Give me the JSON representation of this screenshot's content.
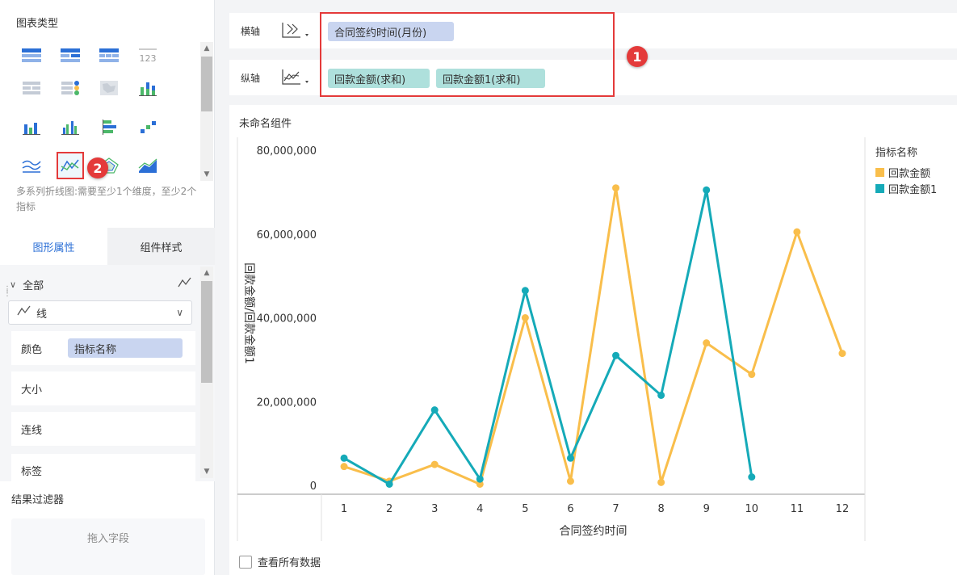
{
  "left_panel": {
    "chart_type_title": "图表类型",
    "icon_123_label": "123",
    "hint": "多系列折线图:需要至少1个维度，至少2个指标",
    "badge_2": "2",
    "tabs": [
      {
        "label": "图形属性"
      },
      {
        "label": "组件样式"
      }
    ],
    "all_label": "全部",
    "line_select_label": "线",
    "color_label": "颜色",
    "color_field": "指标名称",
    "size_label": "大小",
    "connect_label": "连线",
    "tag_label": "标签",
    "filter_title": "结果过滤器",
    "drop_field": "拖入字段"
  },
  "axes": {
    "x_label": "横轴",
    "x_field": "合同签约时间(月份)",
    "y_label": "纵轴",
    "y_fields": [
      "回款金额(求和)",
      "回款金额1(求和)"
    ],
    "badge_1": "1"
  },
  "chart_panel": {
    "title": "未命名组件",
    "view_all": "查看所有数据"
  },
  "colors": {
    "series1": "#f9be4b",
    "series2": "#15aab8",
    "accent_red": "#e43a3a",
    "active_tab": "#2b6fd6"
  },
  "chart_data": {
    "type": "line",
    "x": [
      1,
      2,
      3,
      4,
      5,
      6,
      7,
      8,
      9,
      10,
      11,
      12
    ],
    "xlabel": "合同签约时间",
    "ylabel": "回款金额/回款金额1",
    "ylim": [
      0,
      80000000
    ],
    "yticks": [
      "0",
      "20,000,000",
      "40,000,000",
      "60,000,000",
      "80,000,000"
    ],
    "ytick_values": [
      0,
      20000000,
      40000000,
      60000000,
      80000000
    ],
    "legend_title": "指标名称",
    "series": [
      {
        "name": "回款金额",
        "color": "#f9be4b",
        "values": [
          4500000,
          1000000,
          5000000,
          300000,
          40000000,
          1000000,
          71000000,
          700000,
          34000000,
          26500000,
          60500000,
          31500000
        ]
      },
      {
        "name": "回款金额1",
        "color": "#15aab8",
        "values": [
          6500000,
          300000,
          18000000,
          1500000,
          46500000,
          6500000,
          31000000,
          21500000,
          70500000,
          2000000,
          null,
          null
        ]
      }
    ]
  }
}
